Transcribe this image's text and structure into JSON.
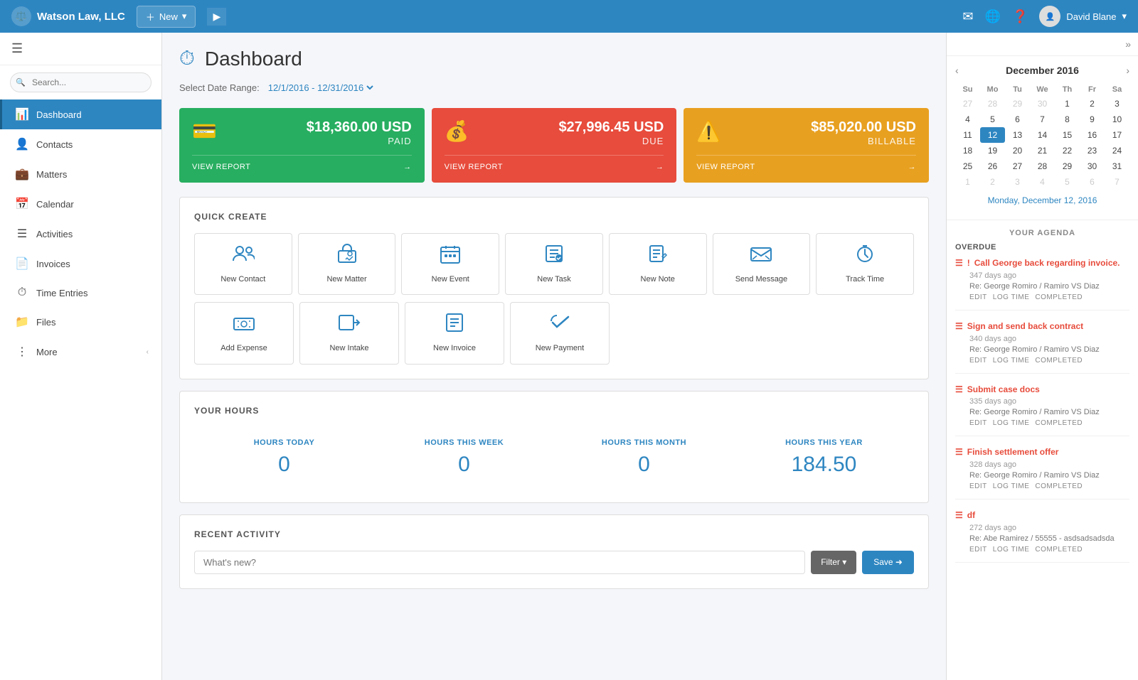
{
  "topNav": {
    "brand": "Watson Law, LLC",
    "newBtn": "New",
    "user": "David Blane"
  },
  "sidebar": {
    "searchPlaceholder": "Search...",
    "items": [
      {
        "id": "dashboard",
        "label": "Dashboard",
        "icon": "📊",
        "active": true
      },
      {
        "id": "contacts",
        "label": "Contacts",
        "icon": "👤"
      },
      {
        "id": "matters",
        "label": "Matters",
        "icon": "💼"
      },
      {
        "id": "calendar",
        "label": "Calendar",
        "icon": "📅"
      },
      {
        "id": "activities",
        "label": "Activities",
        "icon": "☰"
      },
      {
        "id": "invoices",
        "label": "Invoices",
        "icon": "📄"
      },
      {
        "id": "time-entries",
        "label": "Time Entries",
        "icon": "⏱"
      },
      {
        "id": "files",
        "label": "Files",
        "icon": "📁"
      },
      {
        "id": "more",
        "label": "More",
        "icon": "⋮⋮"
      }
    ]
  },
  "dashboard": {
    "title": "Dashboard",
    "dateRangeLabel": "Select Date Range:",
    "dateRange": "12/1/2016 - 12/31/2016",
    "stats": [
      {
        "id": "paid",
        "amount": "$18,360.00 USD",
        "label": "PAID",
        "link": "VIEW REPORT",
        "color": "green"
      },
      {
        "id": "due",
        "amount": "$27,996.45 USD",
        "label": "DUE",
        "link": "VIEW REPORT",
        "color": "red"
      },
      {
        "id": "billable",
        "amount": "$85,020.00 USD",
        "label": "BILLABLE",
        "link": "VIEW REPORT",
        "color": "orange"
      }
    ],
    "quickCreate": {
      "title": "QUICK CREATE",
      "row1": [
        {
          "id": "new-contact",
          "label": "New Contact",
          "icon": "👥"
        },
        {
          "id": "new-matter",
          "label": "New Matter",
          "icon": "💼"
        },
        {
          "id": "new-event",
          "label": "New Event",
          "icon": "📅"
        },
        {
          "id": "new-task",
          "label": "New Task",
          "icon": "📋"
        },
        {
          "id": "new-note",
          "label": "New Note",
          "icon": "✏️"
        },
        {
          "id": "send-message",
          "label": "Send Message",
          "icon": "✉️"
        },
        {
          "id": "track-time",
          "label": "Track Time",
          "icon": "⏱"
        }
      ],
      "row2": [
        {
          "id": "add-expense",
          "label": "Add Expense",
          "icon": "💵"
        },
        {
          "id": "new-intake",
          "label": "New Intake",
          "icon": "➡️"
        },
        {
          "id": "new-invoice",
          "label": "New Invoice",
          "icon": "📄"
        },
        {
          "id": "new-payment",
          "label": "New Payment",
          "icon": "👆"
        }
      ]
    },
    "yourHours": {
      "title": "YOUR HOURS",
      "items": [
        {
          "label": "HOURS TODAY",
          "value": "0"
        },
        {
          "label": "HOURS THIS WEEK",
          "value": "0"
        },
        {
          "label": "HOURS THIS MONTH",
          "value": "0"
        },
        {
          "label": "HOURS THIS YEAR",
          "value": "184.50"
        }
      ]
    },
    "recentActivity": {
      "title": "RECENT ACTIVITY",
      "inputPlaceholder": "What's new?",
      "filterBtn": "Filter ▾",
      "saveBtn": "Save ➜"
    }
  },
  "rightPanel": {
    "calendar": {
      "month": "December 2016",
      "days": [
        "Su",
        "Mo",
        "Tu",
        "We",
        "Th",
        "Fr",
        "Sa"
      ],
      "weeks": [
        [
          "27",
          "28",
          "29",
          "30",
          "1",
          "2",
          "3"
        ],
        [
          "4",
          "5",
          "6",
          "7",
          "8",
          "9",
          "10"
        ],
        [
          "11",
          "12",
          "13",
          "14",
          "15",
          "16",
          "17"
        ],
        [
          "18",
          "19",
          "20",
          "21",
          "22",
          "23",
          "24"
        ],
        [
          "25",
          "26",
          "27",
          "28",
          "29",
          "30",
          "31"
        ],
        [
          "1",
          "2",
          "3",
          "4",
          "5",
          "6",
          "7"
        ]
      ],
      "otherMonth": [
        "27",
        "28",
        "29",
        "30",
        "1",
        "2",
        "3",
        "1",
        "2",
        "3",
        "4",
        "5",
        "6",
        "7"
      ],
      "today": "12",
      "todayLink": "Monday, December 12, 2016"
    },
    "agenda": {
      "title": "YOUR AGENDA",
      "overdueLabel": "OVERDUE",
      "items": [
        {
          "title": "Call George back regarding invoice.",
          "meta": "347 days ago",
          "re": "Re: George Romiro / Ramiro VS Diaz",
          "actions": [
            "EDIT",
            "LOG TIME",
            "COMPLETED"
          ]
        },
        {
          "title": "Sign and send back contract",
          "meta": "340 days ago",
          "re": "Re: George Romiro / Ramiro VS Diaz",
          "actions": [
            "EDIT",
            "LOG TIME",
            "COMPLETED"
          ]
        },
        {
          "title": "Submit case docs",
          "meta": "335 days ago",
          "re": "Re: George Romiro / Ramiro VS Diaz",
          "actions": [
            "EDIT",
            "LOG TIME",
            "COMPLETED"
          ]
        },
        {
          "title": "Finish settlement offer",
          "meta": "328 days ago",
          "re": "Re: George Romiro / Ramiro VS Diaz",
          "actions": [
            "EDIT",
            "LOG TIME",
            "COMPLETED"
          ]
        },
        {
          "title": "df",
          "meta": "272 days ago",
          "re": "Re: Abe Ramirez / 55555 - asdsadsadsda",
          "actions": [
            "EDIT",
            "LOG TIME",
            "COMPLETED"
          ]
        }
      ]
    }
  }
}
